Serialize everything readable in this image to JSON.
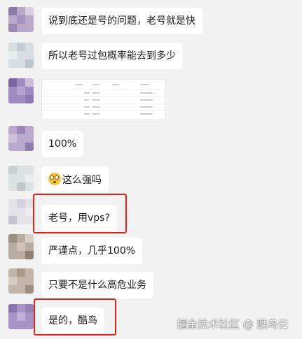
{
  "messages": [
    {
      "type": "text",
      "text": "说到底还是号的问题，老号就是快"
    },
    {
      "type": "text",
      "text": "所以老号过包概率能去到多少"
    },
    {
      "type": "image",
      "alt": "table screenshot"
    },
    {
      "type": "text",
      "text": "100%"
    },
    {
      "type": "text",
      "text": "这么强吗",
      "emoji": "flushed-face"
    },
    {
      "type": "text",
      "text": "老号，用vps?",
      "highlighted": true
    },
    {
      "type": "text",
      "text": "严谨点，几乎100%"
    },
    {
      "type": "text",
      "text": "只要不是什么高危业务"
    },
    {
      "type": "text",
      "text": "是的，酷鸟",
      "highlighted": true
    }
  ],
  "watermark": {
    "text": "掘金技术社区 @ 酷鸟云"
  },
  "colors": {
    "background": "#f2f2f2",
    "bubble": "#ffffff",
    "highlight": "#e2231a"
  }
}
